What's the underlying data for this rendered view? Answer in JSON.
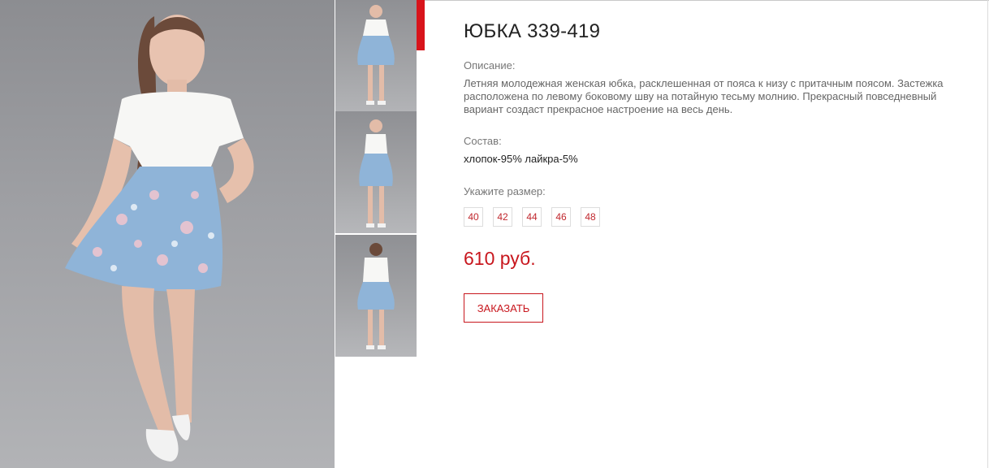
{
  "product": {
    "title": "ЮБКА 339-419",
    "description_label": "Описание:",
    "description": "Летняя молодежная женская юбка, расклешенная от пояса к низу с притачным поясом. Застежка расположена по левому боковому шву на потайную тесьму молнию. Прекрасный повседневный вариант создаст прекрасное настроение на весь день.",
    "composition_label": "Состав:",
    "composition": "хлопок-95% лайкра-5%",
    "size_label": "Укажите размер:",
    "sizes": [
      "40",
      "42",
      "44",
      "46",
      "48"
    ],
    "price": "610 руб.",
    "order_button": "ЗАКАЗАТЬ"
  },
  "gallery": {
    "thumbnails": [
      "front-view",
      "three-quarter-view",
      "back-view"
    ]
  },
  "colors": {
    "accent": "#d8141b",
    "price": "#c8171e",
    "size_text": "#c0272d",
    "photo_background": "#9fa0a4"
  }
}
